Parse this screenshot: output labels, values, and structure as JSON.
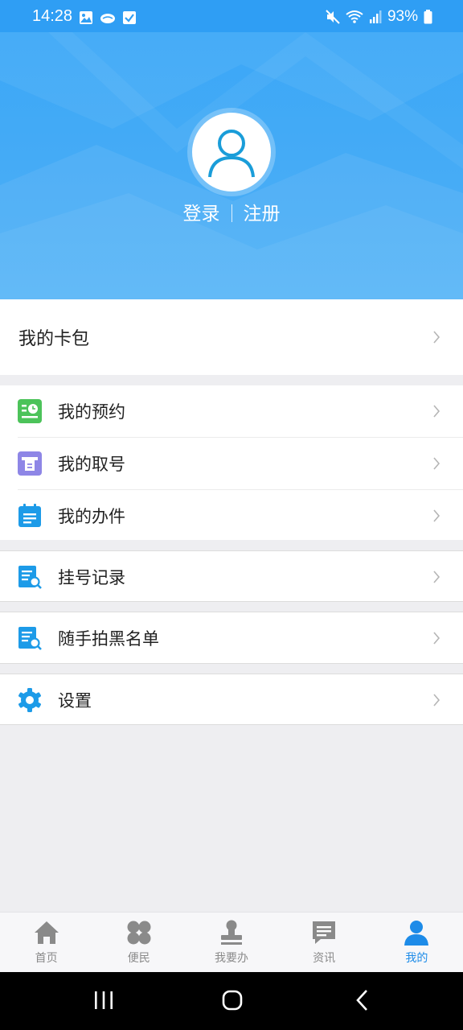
{
  "status_bar": {
    "time": "14:28",
    "battery": "93%",
    "icons": [
      "gallery-icon",
      "cloud-icon",
      "check-icon",
      "mute-icon",
      "wifi-icon",
      "signal-icon",
      "battery-icon"
    ]
  },
  "header": {
    "avatar_icon": "user-avatar-icon",
    "login": "登录",
    "register": "注册"
  },
  "menu": {
    "card_wallet": "我的卡包",
    "appointment": "我的预约",
    "ticket": "我的取号",
    "affairs": "我的办件",
    "registration_record": "挂号记录",
    "blacklist": "随手拍黑名单",
    "settings": "设置"
  },
  "bottom_nav": {
    "items": [
      {
        "label": "首页",
        "icon": "home-icon"
      },
      {
        "label": "便民",
        "icon": "grid-icon"
      },
      {
        "label": "我要办",
        "icon": "stamp-icon"
      },
      {
        "label": "资讯",
        "icon": "message-icon"
      },
      {
        "label": "我的",
        "icon": "person-icon"
      }
    ],
    "active": "我的"
  },
  "colors": {
    "primary": "#1d8be8",
    "header": "#3ba7f7",
    "green": "#4cc35a",
    "purple": "#8e86e6"
  }
}
